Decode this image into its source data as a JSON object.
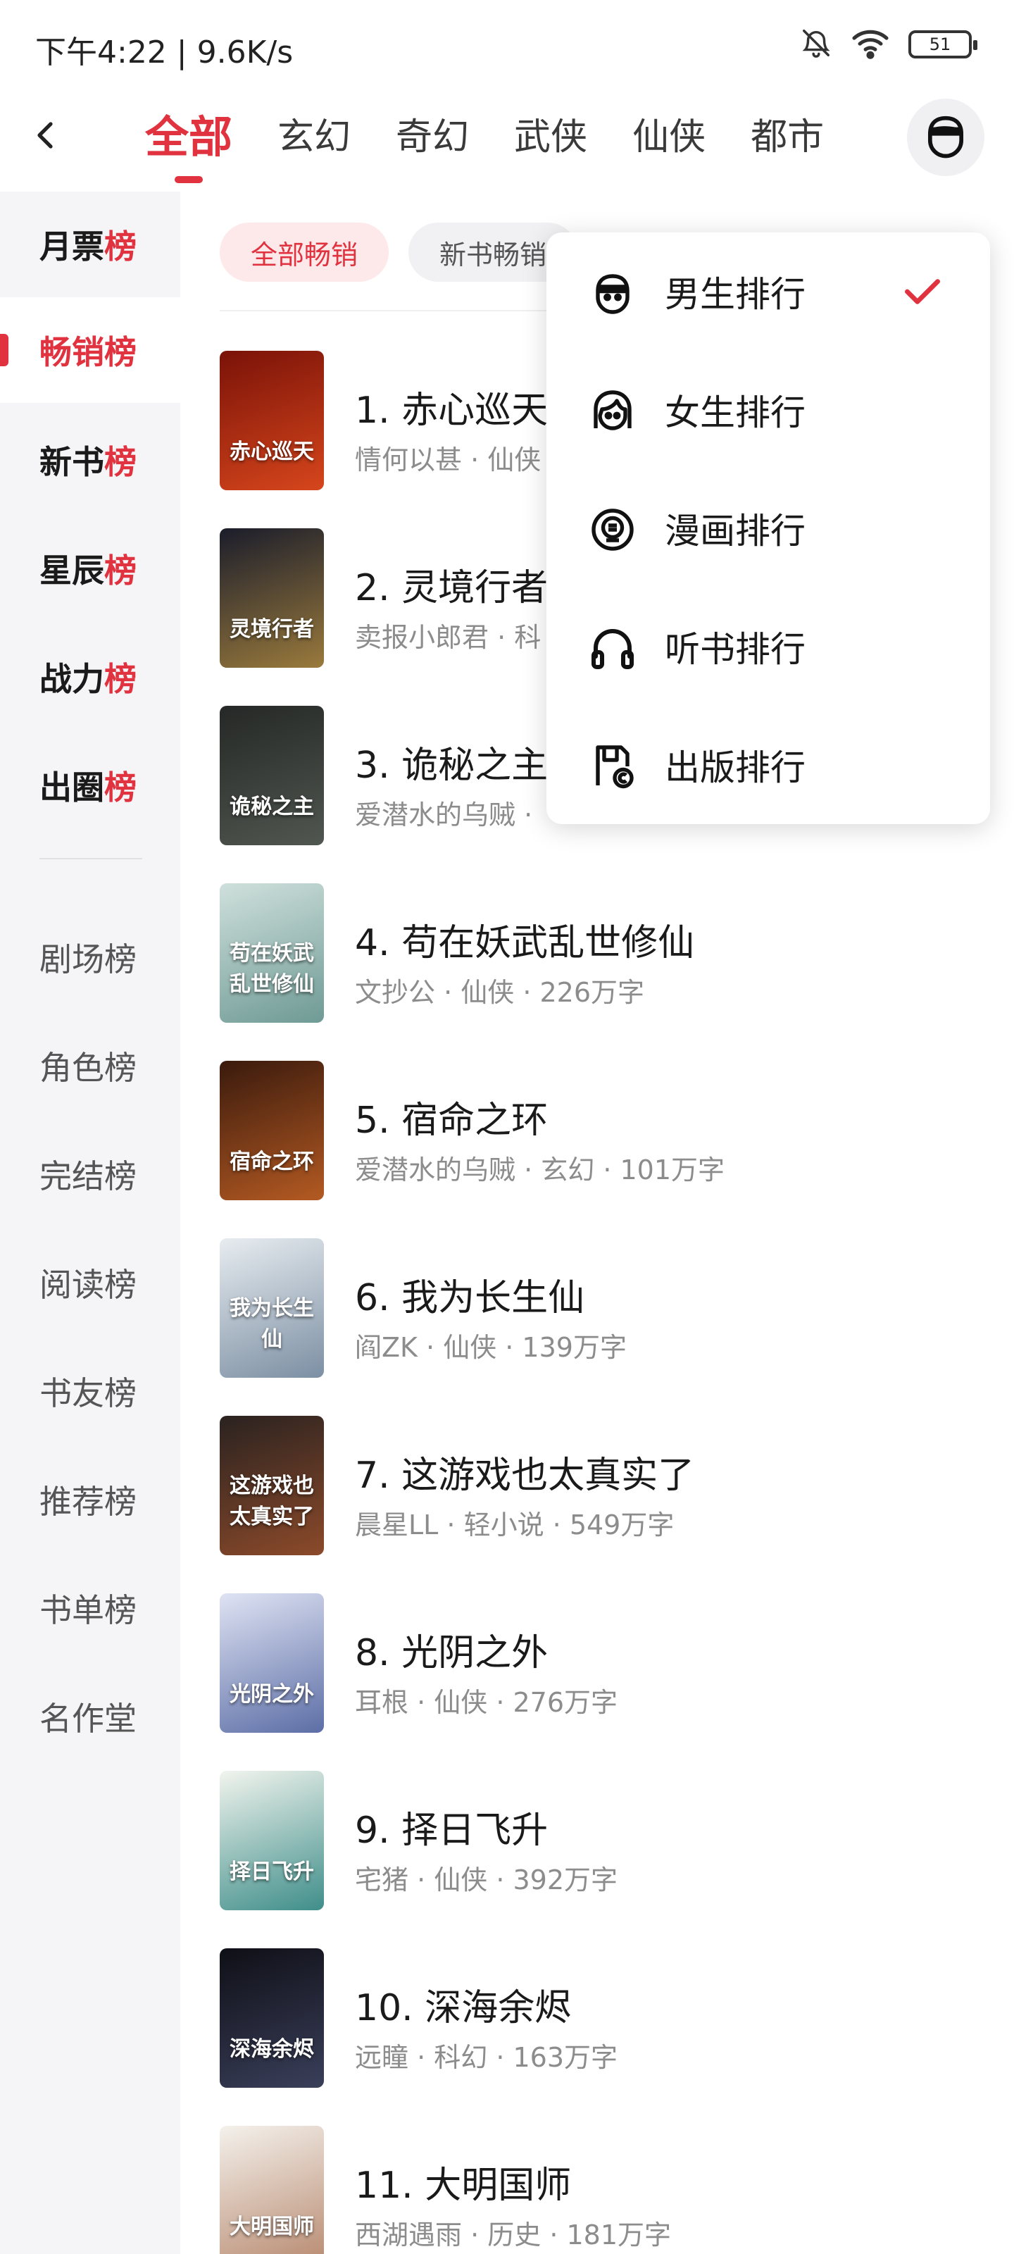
{
  "status_bar": {
    "time": "下午4:22 | 9.6K/s",
    "battery": "51"
  },
  "nav": {
    "tabs": [
      {
        "label": "全部",
        "active": true
      },
      {
        "label": "玄幻",
        "active": false
      },
      {
        "label": "奇幻",
        "active": false
      },
      {
        "label": "武侠",
        "active": false
      },
      {
        "label": "仙侠",
        "active": false
      },
      {
        "label": "都市",
        "active": false
      }
    ]
  },
  "sidebar": {
    "primary": [
      {
        "label": "月票",
        "hot": "榜"
      },
      {
        "label": "畅销榜",
        "hot": "",
        "active": true
      },
      {
        "label": "新书",
        "hot": "榜"
      },
      {
        "label": "星辰",
        "hot": "榜"
      },
      {
        "label": "战力",
        "hot": "榜"
      },
      {
        "label": "出圈",
        "hot": "榜"
      }
    ],
    "secondary": [
      "剧场榜",
      "角色榜",
      "完结榜",
      "阅读榜",
      "书友榜",
      "推荐榜",
      "书单榜",
      "名作堂"
    ]
  },
  "filters": [
    {
      "label": "全部畅销",
      "active": true
    },
    {
      "label": "新书畅销",
      "active": false
    }
  ],
  "books": [
    {
      "title": "1. 赤心巡天",
      "meta": "情何以甚 · 仙侠",
      "cover_text": "赤心巡天",
      "cover_colors": [
        "#7a1208",
        "#d6461c"
      ]
    },
    {
      "title": "2. 灵境行者",
      "meta": "卖报小郎君 · 科",
      "cover_text": "灵境行者",
      "cover_colors": [
        "#1b1d2b",
        "#9a7a3c"
      ]
    },
    {
      "title": "3. 诡秘之主",
      "meta": "爱潜水的乌贼 ·",
      "cover_text": "诡秘之主",
      "cover_colors": [
        "#252826",
        "#505650"
      ]
    },
    {
      "title": "4. 苟在妖武乱世修仙",
      "meta": "文抄公 · 仙侠 · 226万字",
      "cover_text": "苟在妖武乱世修仙",
      "cover_colors": [
        "#cfe0dc",
        "#6f9a95"
      ]
    },
    {
      "title": "5. 宿命之环",
      "meta": "爱潜水的乌贼 · 玄幻 · 101万字",
      "cover_text": "宿命之环",
      "cover_colors": [
        "#3a1a0d",
        "#b45a22"
      ]
    },
    {
      "title": "6. 我为长生仙",
      "meta": "阎ZK · 仙侠 · 139万字",
      "cover_text": "我为长生仙",
      "cover_colors": [
        "#e7ecf0",
        "#7c8fa3"
      ]
    },
    {
      "title": "7. 这游戏也太真实了",
      "meta": "晨星LL · 轻小说 · 549万字",
      "cover_text": "这游戏也太真实了",
      "cover_colors": [
        "#2a2220",
        "#8c4a2a"
      ]
    },
    {
      "title": "8. 光阴之外",
      "meta": "耳根 · 仙侠 · 276万字",
      "cover_text": "光阴之外",
      "cover_colors": [
        "#dfe3f3",
        "#5c6ea6"
      ]
    },
    {
      "title": "9. 择日飞升",
      "meta": "宅猪 · 仙侠 · 392万字",
      "cover_text": "择日飞升",
      "cover_colors": [
        "#f2f4ee",
        "#3f8e8a"
      ]
    },
    {
      "title": "10. 深海余烬",
      "meta": "远瞳 · 科幻 · 163万字",
      "cover_text": "深海余烬",
      "cover_colors": [
        "#0f0f16",
        "#3a3f5a"
      ]
    },
    {
      "title": "11. 大明国师",
      "meta": "西湖遇雨 · 历史 · 181万字",
      "cover_text": "大明国师",
      "cover_colors": [
        "#f4f1ec",
        "#b88a70"
      ]
    }
  ],
  "dropdown": {
    "items": [
      {
        "label": "男生排行",
        "icon": "male-face-icon",
        "selected": true
      },
      {
        "label": "女生排行",
        "icon": "female-face-icon",
        "selected": false
      },
      {
        "label": "漫画排行",
        "icon": "comic-icon",
        "selected": false
      },
      {
        "label": "听书排行",
        "icon": "headphones-icon",
        "selected": false
      },
      {
        "label": "出版排行",
        "icon": "publish-icon",
        "selected": false
      }
    ]
  },
  "colors": {
    "accent": "#e0323f",
    "sidebar_bg": "#f5f5f7",
    "meta_text": "#8c8c8c"
  }
}
